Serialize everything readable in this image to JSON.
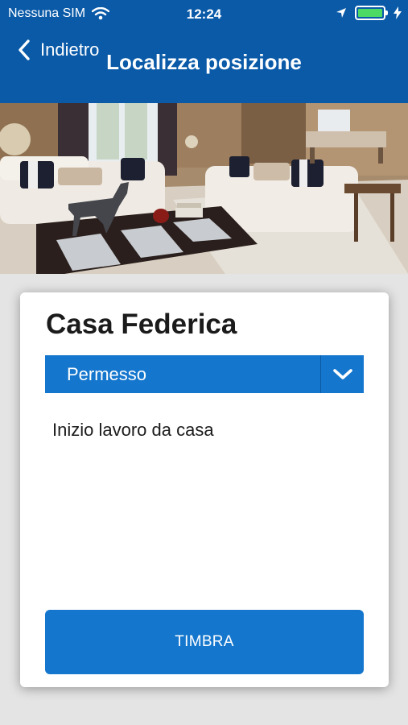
{
  "status_bar": {
    "carrier": "Nessuna SIM",
    "time": "12:24",
    "battery_level": 1.0,
    "battery_color": "#4cd964"
  },
  "nav": {
    "back_label": "Indietro",
    "title": "Localizza posizione",
    "background": "#0a5aa8"
  },
  "card": {
    "title": "Casa Federica",
    "select": {
      "value": "Permesso",
      "icon": "chevron-down-icon"
    },
    "description": "Inizio lavoro da casa",
    "button_label": "TIMBRA",
    "accent": "#1476cd"
  }
}
